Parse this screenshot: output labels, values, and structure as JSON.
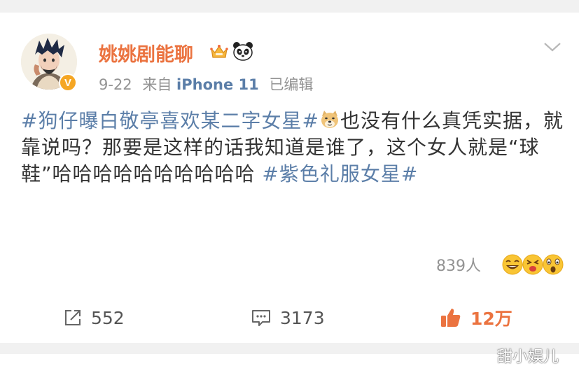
{
  "post": {
    "username": "姚姚剧能聊",
    "date": "9-22",
    "source_prefix": "来自",
    "device": "iPhone 11",
    "edited": "已编辑",
    "topic_1": "#狗仔曝白敬亭喜欢某二字女星#",
    "text_1": "也没有什么真凭实据，就靠说吗？那要是这样的话我知道是谁了，这个女人就是“球鞋”哈哈哈哈哈哈哈哈哈哈 ",
    "topic_2": "#紫色礼服女星#",
    "likers_count": "839人"
  },
  "actions": {
    "forward_count": "552",
    "comment_count": "3173",
    "like_count": "12万"
  },
  "watermark": "甜小娱儿",
  "icons": {
    "verified": "verified-v-icon",
    "crown": "crown-badge-icon",
    "panda": "panda-badge-icon",
    "chevron": "chevron-down-icon",
    "doge": "doge-emoji-icon",
    "forward": "forward-icon",
    "comment": "comment-icon",
    "like": "thumbs-up-icon"
  },
  "colors": {
    "username": "#eb7340",
    "topic": "#5b7ea8",
    "meta": "#939393",
    "text": "#333333",
    "like_active": "#eb7340"
  }
}
